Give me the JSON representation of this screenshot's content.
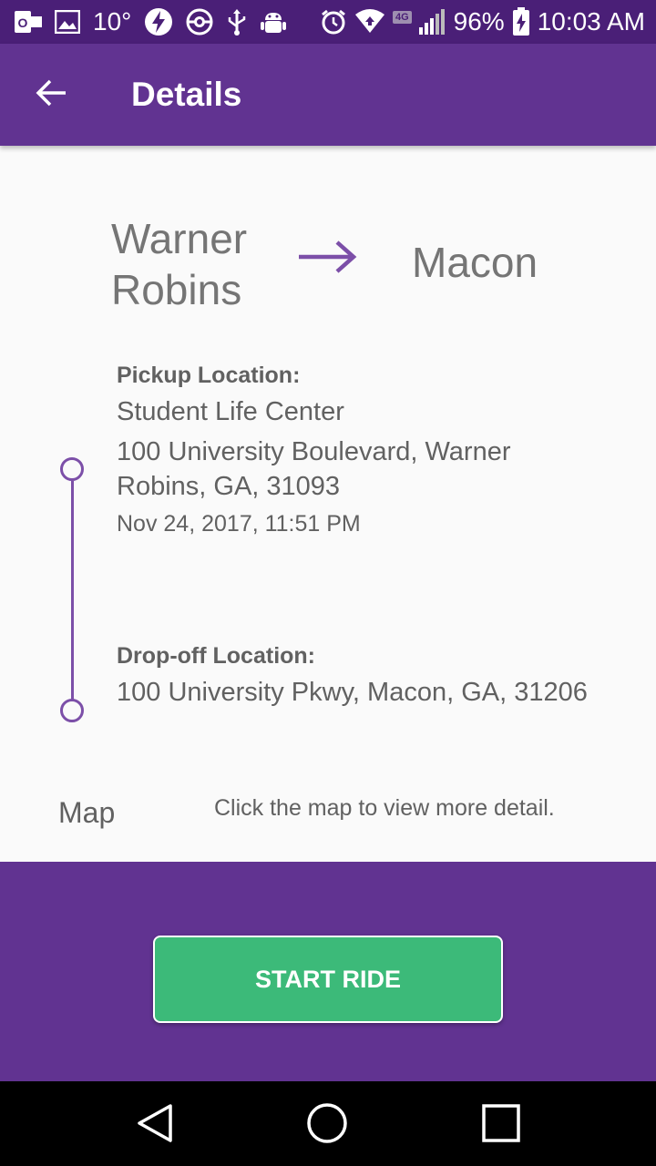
{
  "status_bar": {
    "temperature": "10°",
    "network_type": "4G",
    "battery": "96%",
    "time": "10:03 AM",
    "icons": [
      "outlook-icon",
      "image-icon",
      "flash-icon",
      "pokeball-icon",
      "usb-icon",
      "android-debug-icon",
      "alarm-icon",
      "wifi-icon",
      "signal-icon",
      "battery-charging-icon"
    ]
  },
  "app_bar": {
    "title": "Details",
    "back_icon": "arrow-left-icon"
  },
  "route": {
    "from": "Warner Robins",
    "to": "Macon",
    "arrow_icon": "arrow-right-icon"
  },
  "pickup": {
    "label": "Pickup Location:",
    "name": "Student Life Center",
    "address": "100 University Boulevard, Warner Robins, GA, 31093",
    "datetime": "Nov 24, 2017, 11:51 PM"
  },
  "dropoff": {
    "label": "Drop-off Location:",
    "address": "100 University Pkwy, Macon, GA, 31206"
  },
  "map": {
    "label": "Map",
    "hint": "Click the map to view more detail."
  },
  "action": {
    "start_label": "START RIDE"
  },
  "colors": {
    "primary": "#613391",
    "primary_dark": "#4a1f77",
    "accent_green": "#3cba79",
    "timeline": "#7c4fa8"
  }
}
